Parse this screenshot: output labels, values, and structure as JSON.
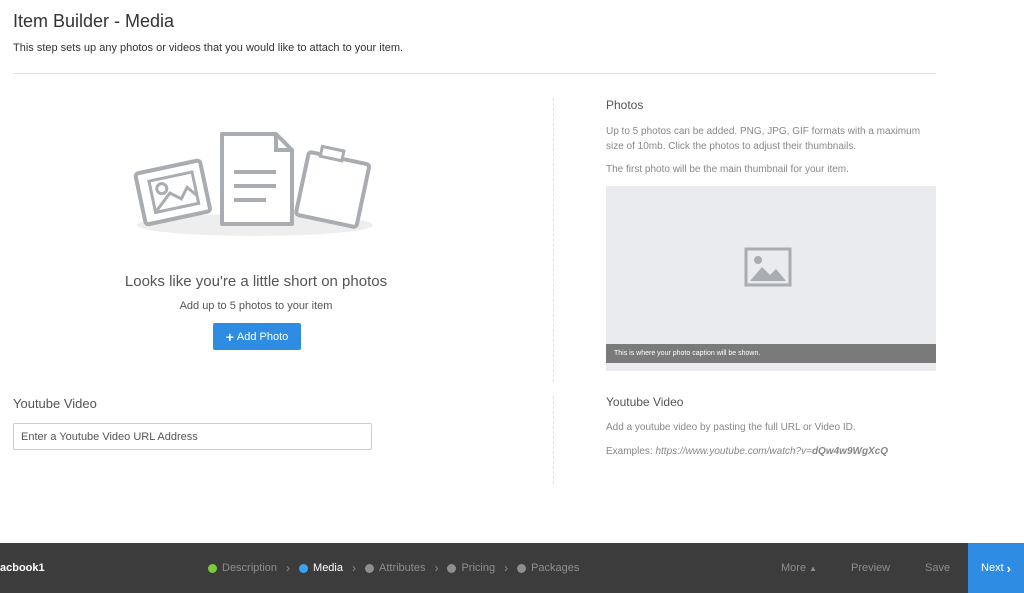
{
  "header": {
    "title": "Item Builder - Media",
    "subtitle": "This step sets up any photos or videos that you would like to attach to your item."
  },
  "empty_state": {
    "heading": "Looks like you're a little short on photos",
    "hint": "Add up to 5 photos to your item",
    "add_button_label": "Add Photo"
  },
  "youtube_left": {
    "title": "Youtube Video",
    "placeholder": "Enter a Youtube Video URL Address"
  },
  "photos": {
    "title": "Photos",
    "description": "Up to 5 photos can be added. PNG, JPG, GIF formats with a maximum size of 10mb. Click the photos to adjust their thumbnails.",
    "note": "The first photo will be the main thumbnail for your item.",
    "caption": "This is where your photo caption will be shown."
  },
  "youtube_right": {
    "title": "Youtube Video",
    "description": "Add a youtube video by pasting the full URL or Video ID.",
    "examples_label": "Examples:",
    "example_url": "https://www.youtube.com/watch?v=",
    "example_id": "dQw4w9WgXcQ"
  },
  "bottom_bar": {
    "item_name": "acbook1",
    "steps": [
      {
        "label": "Description",
        "state": "done"
      },
      {
        "label": "Media",
        "state": "active"
      },
      {
        "label": "Attributes",
        "state": "pending"
      },
      {
        "label": "Pricing",
        "state": "pending"
      },
      {
        "label": "Packages",
        "state": "pending"
      }
    ],
    "more_label": "More",
    "preview_label": "Preview",
    "save_label": "Save",
    "next_label": "Next"
  },
  "colors": {
    "accent": "#2e8de3",
    "step_done": "#7ec93b",
    "step_active": "#3ea0f5",
    "bar_bg": "#3c3c3c"
  }
}
